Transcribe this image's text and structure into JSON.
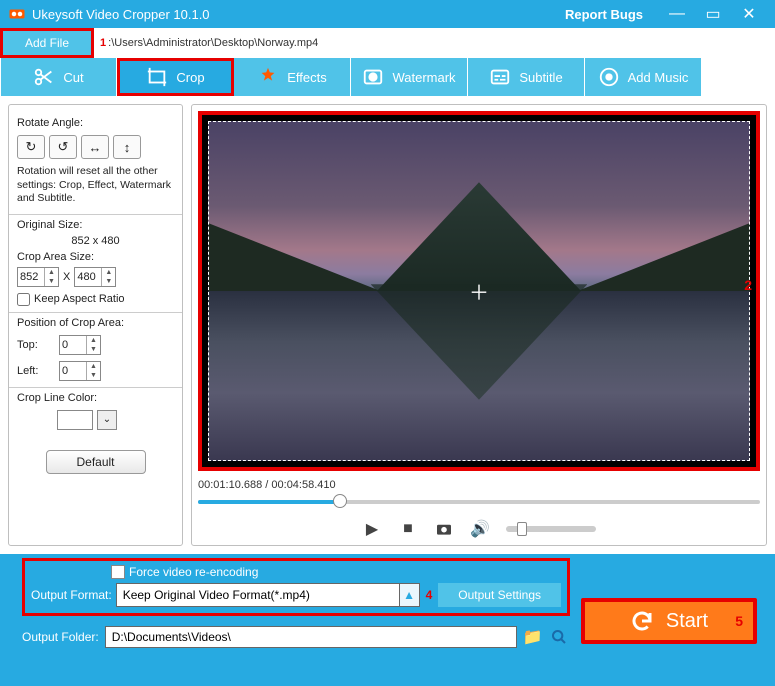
{
  "app": {
    "title": "Ukeysoft Video Cropper 10.1.0",
    "report": "Report Bugs"
  },
  "file": {
    "add_label": "Add File",
    "marker1": "1",
    "path": ":\\Users\\Administrator\\Desktop\\Norway.mp4"
  },
  "tabs": {
    "cut": "Cut",
    "crop": "Crop",
    "effects": "Effects",
    "watermark": "Watermark",
    "subtitle": "Subtitle",
    "addmusic": "Add Music"
  },
  "crop": {
    "rotate_label": "Rotate Angle:",
    "note": "Rotation will reset all the other settings: Crop, Effect, Watermark and Subtitle.",
    "orig_label": "Original Size:",
    "orig_value": "852 x 480",
    "area_label": "Crop Area Size:",
    "area_w": "852",
    "area_x": "X",
    "area_h": "480",
    "keep_ratio": "Keep Aspect Ratio",
    "pos_label": "Position of Crop Area:",
    "top_label": "Top:",
    "top_val": "0",
    "left_label": "Left:",
    "left_val": "0",
    "color_label": "Crop Line Color:",
    "default_btn": "Default"
  },
  "preview": {
    "marker2": "2",
    "time": "00:01:10.688 / 00:04:58.410"
  },
  "output": {
    "reencode": "Force video re-encoding",
    "format_label": "Output Format:",
    "format_value": "Keep Original Video Format(*.mp4)",
    "marker4": "4",
    "settings_btn": "Output Settings",
    "start_btn": "Start",
    "marker5": "5",
    "folder_label": "Output Folder:",
    "folder_value": "D:\\Documents\\Videos\\"
  }
}
